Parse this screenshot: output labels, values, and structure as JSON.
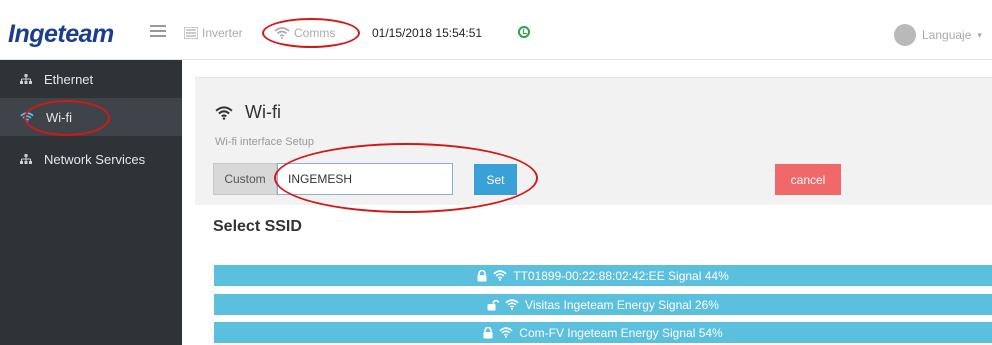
{
  "header": {
    "logo": "Ingeteam",
    "nav": [
      {
        "label": "Inverter",
        "icon": "list-icon"
      },
      {
        "label": "Comms",
        "icon": "wifi-icon"
      }
    ],
    "datetime": "01/15/2018 15:54:51",
    "language_label": "Languaje"
  },
  "sidebar": {
    "items": [
      {
        "label": "Ethernet",
        "icon": "network-icon",
        "active": false
      },
      {
        "label": "Wi-fi",
        "icon": "wifi-icon",
        "active": true
      },
      {
        "label": "Network Services",
        "icon": "network-icon",
        "active": false
      }
    ]
  },
  "main": {
    "title": "Wi-fi",
    "subtitle": "Wi-fi interface Setup",
    "custom_label": "Custom",
    "ssid_value": "INGEMESH",
    "set_label": "Set",
    "cancel_label": "cancel",
    "select_ssid_label": "Select SSID",
    "networks": [
      {
        "text": "TT01899-00:22:88:02:42:EE  Signal 44%",
        "lock": "locked"
      },
      {
        "text": "Visitas Ingeteam Energy  Signal 26%",
        "lock": "unlocked"
      },
      {
        "text": "Com-FV Ingeteam Energy  Signal 54%",
        "lock": "locked"
      }
    ]
  },
  "colors": {
    "accent": "#3aa1d8",
    "ssid_row": "#5bc0de",
    "cancel": "#f0686a",
    "sidebar": "#2e3338",
    "annotation": "#d41818"
  }
}
